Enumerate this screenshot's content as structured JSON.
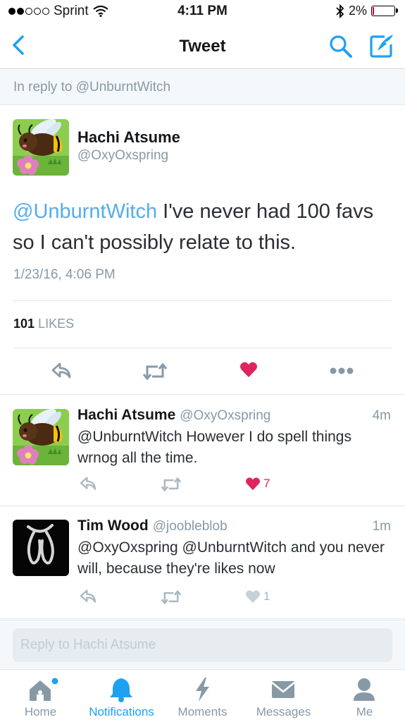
{
  "status_bar": {
    "carrier": "Sprint",
    "time": "4:11 PM",
    "battery": "2%",
    "signal_bars": 2,
    "icons": [
      "wifi-icon",
      "bluetooth-icon",
      "battery-icon"
    ]
  },
  "nav": {
    "title": "Tweet",
    "icons": [
      "back-chevron-icon",
      "search-icon",
      "compose-icon"
    ],
    "accent": "#1da1f2"
  },
  "reply_banner": "In reply to @UnburntWitch",
  "main_tweet": {
    "name": "Hachi Atsume",
    "handle": "@OxyOxspring",
    "mention": "@UnburntWitch",
    "text": " I've never had 100 favs so I can't possibly relate to this.",
    "timestamp": "1/23/16, 4:06 PM",
    "likes_count": "101",
    "likes_label": "LIKES",
    "liked": true,
    "actions": [
      "reply-icon",
      "retweet-icon",
      "heart-icon",
      "more-icon"
    ]
  },
  "replies": [
    {
      "name": "Hachi Atsume",
      "handle": "@OxyOxspring",
      "time": "4m",
      "text": "@UnburntWitch However I do spell things wrnog all the time.",
      "likes": "7",
      "liked": true,
      "avatar": "bee-avatar"
    },
    {
      "name": "Tim Wood",
      "handle": "@joobleblob",
      "time": "1m",
      "text": "@OxyOxspring @UnburntWitch and you never will, because they're likes now",
      "likes": "1",
      "liked": false,
      "avatar": "glyph-avatar"
    }
  ],
  "reply_input": {
    "placeholder": "Reply to Hachi Atsume"
  },
  "tabs": [
    {
      "label": "Home",
      "icon": "home-icon",
      "active": false,
      "badge": true
    },
    {
      "label": "Notifications",
      "icon": "bell-icon",
      "active": true
    },
    {
      "label": "Moments",
      "icon": "lightning-icon",
      "active": false
    },
    {
      "label": "Messages",
      "icon": "envelope-icon",
      "active": false
    },
    {
      "label": "Me",
      "icon": "person-icon",
      "active": false
    }
  ],
  "colors": {
    "accent": "#1da1f2",
    "like": "#e0245e",
    "muted": "#8899a6",
    "mention": "#55acee"
  }
}
